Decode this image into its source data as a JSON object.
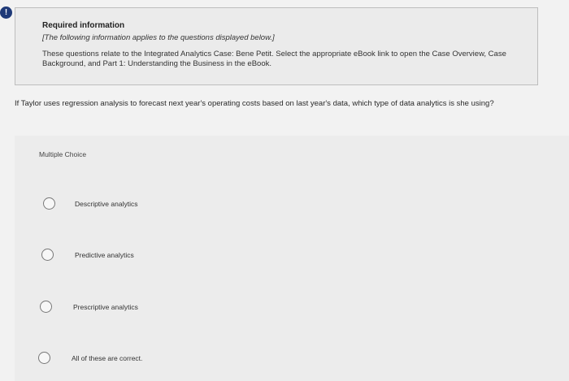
{
  "alert": {
    "icon": "exclamation-circle-icon",
    "glyph": "!",
    "color": "#1f3a78"
  },
  "info": {
    "title": "Required information",
    "subtitle": "[The following information applies to the questions displayed below.]",
    "body": "These questions relate to the Integrated Analytics Case: Bene Petit. Select the appropriate eBook link to open the Case Overview, Case Background, and Part 1: Understanding the Business in the eBook."
  },
  "question": {
    "text": "If Taylor uses regression analysis to forecast next year's operating costs based on last year's data, which type of data analytics is she using?"
  },
  "multiple_choice": {
    "header": "Multiple Choice",
    "options": [
      {
        "label": "Descriptive analytics",
        "selected": false
      },
      {
        "label": "Predictive analytics",
        "selected": false
      },
      {
        "label": "Prescriptive analytics",
        "selected": false
      },
      {
        "label": "All of these are correct.",
        "selected": false
      }
    ]
  }
}
